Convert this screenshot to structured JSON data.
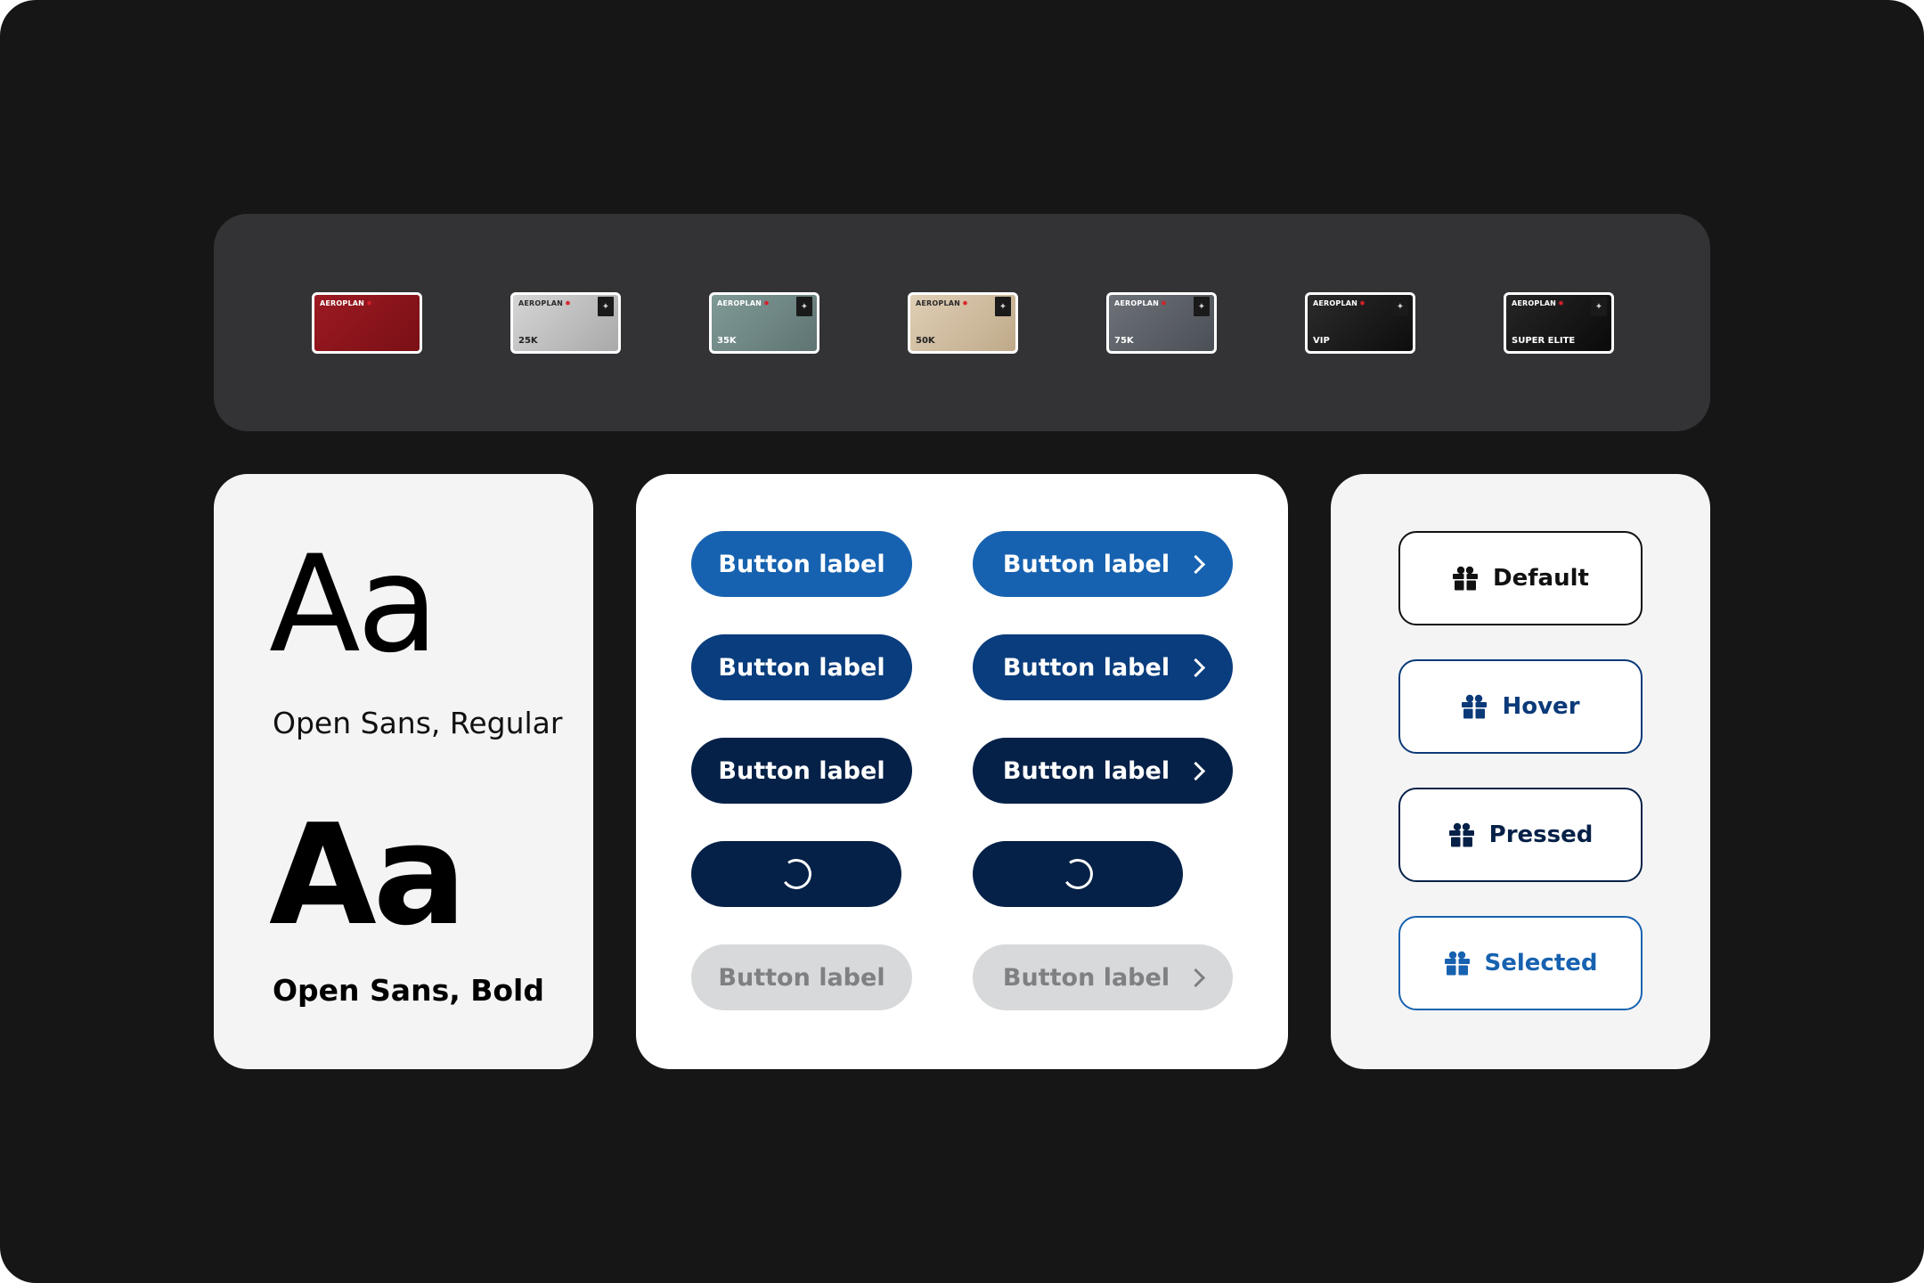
{
  "tier_cards": {
    "brand": "AEROPLAN",
    "items": [
      {
        "tier": "",
        "gradient": [
          "#9c1a22",
          "#7a0f16"
        ],
        "light": false,
        "badge": false
      },
      {
        "tier": "25K",
        "gradient": [
          "#d5d5d5",
          "#a9a9a9"
        ],
        "light": true,
        "badge": true
      },
      {
        "tier": "35K",
        "gradient": [
          "#7f9a97",
          "#5f7473"
        ],
        "light": false,
        "badge": true
      },
      {
        "tier": "50K",
        "gradient": [
          "#e0cfb5",
          "#bfa98a"
        ],
        "light": true,
        "badge": true
      },
      {
        "tier": "75K",
        "gradient": [
          "#6d7178",
          "#4b4f56"
        ],
        "light": false,
        "badge": true
      },
      {
        "tier": "VIP",
        "gradient": [
          "#2b2b2b",
          "#0d0d0d"
        ],
        "light": false,
        "badge": true
      },
      {
        "tier": "SUPER ELITE",
        "gradient": [
          "#262626",
          "#0a0a0a"
        ],
        "light": false,
        "badge": true
      }
    ]
  },
  "typography": {
    "regular_sample": "Aa",
    "regular_label": "Open Sans, Regular",
    "bold_sample": "Aa",
    "bold_label": "Open Sans, Bold"
  },
  "buttons": {
    "label": "Button label",
    "colors": {
      "default": "#1762b0",
      "hover": "#093d7d",
      "pressed": "#062148",
      "disabled": "#d8d9da"
    }
  },
  "states": {
    "default": "Default",
    "hover": "Hover",
    "pressed": "Pressed",
    "selected": "Selected",
    "icon": "gift-icon"
  }
}
